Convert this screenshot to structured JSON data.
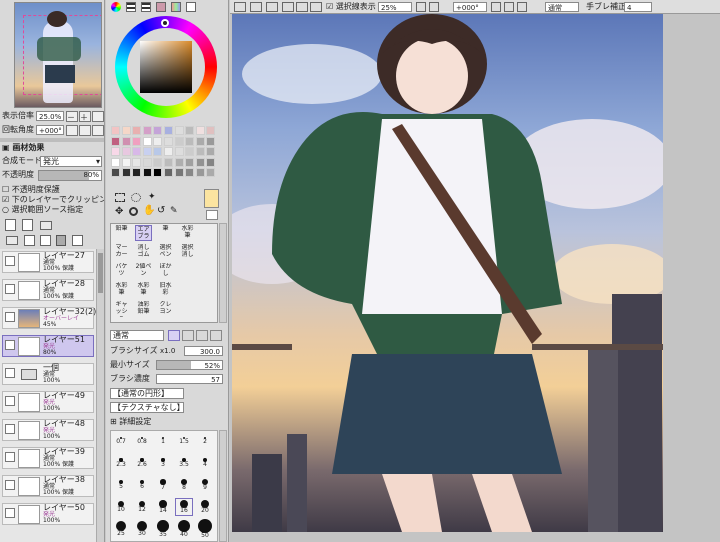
{
  "navigator": {
    "zoom_label": "表示倍率",
    "zoom_value": "25.0%",
    "rotate_label": "回転角度",
    "rotate_value": "+000°"
  },
  "effects": {
    "header": "画材効果",
    "blend_label": "合成モード",
    "blend_value": "発光",
    "opacity_label": "不透明度",
    "opacity_value": "80%",
    "opacity_fraction": 0.8,
    "check_protect": "不透明度保護",
    "check_clip": "下のレイヤーでクリッピング",
    "check_source": "選択範囲ソース指定"
  },
  "layers": [
    {
      "name": "レイヤー27",
      "mode": "通常",
      "opacity": "100% 保護"
    },
    {
      "name": "レイヤー28",
      "mode": "通常",
      "opacity": "100% 保護"
    },
    {
      "name": "レイヤー32(2)",
      "mode": "オーバーレイ",
      "opacity": "45%"
    },
    {
      "name": "レイヤー51",
      "mode": "発光",
      "opacity": "80%"
    },
    {
      "name": "一個",
      "mode": "通常",
      "opacity": "100%"
    },
    {
      "name": "レイヤー49",
      "mode": "発光",
      "opacity": "100%"
    },
    {
      "name": "レイヤー48",
      "mode": "発光",
      "opacity": "100%"
    },
    {
      "name": "レイヤー39",
      "mode": "通常",
      "opacity": "100% 保護"
    },
    {
      "name": "レイヤー38",
      "mode": "通常",
      "opacity": "100% 保護"
    },
    {
      "name": "レイヤー50",
      "mode": "発光",
      "opacity": "100%"
    }
  ],
  "tools": {
    "row1": [
      "鉛筆",
      "エアブラシ",
      "筆",
      "水彩筆"
    ],
    "row2": [
      "マーカー",
      "消しゴム",
      "選択ペン",
      "選択消し"
    ],
    "row3": [
      "バケツ",
      "2値ペン",
      "ぼかし",
      ""
    ],
    "row4": [
      "水彩筆",
      "水彩筆",
      "旧水彩",
      ""
    ],
    "row5": [
      "ギャッシュ",
      "油彩鉛筆",
      "クレヨン",
      ""
    ]
  },
  "brush": {
    "mode_value": "通常",
    "size_label": "ブラシサイズ",
    "size_mult": "x1.0",
    "size_value": "300.0",
    "min_label": "最小サイズ",
    "min_value": "52%",
    "density_label": "ブラシ濃度",
    "density_value": "57",
    "shape_value": "【通常の円形】",
    "texture_value": "【テクスチャなし】",
    "detail_label": "詳細設定",
    "sizes_row1": [
      "0.7",
      "0.8",
      "1",
      "1.5",
      "2"
    ],
    "sizes_row2": [
      "2.3",
      "2.6",
      "3",
      "3.5",
      "4"
    ],
    "sizes_row3": [
      "5",
      "6",
      "7",
      "8",
      "9"
    ],
    "sizes_row4": [
      "10",
      "12",
      "14",
      "16",
      "20"
    ],
    "sizes_row5": [
      "25",
      "30",
      "35",
      "40",
      "50"
    ]
  },
  "toolbar": {
    "select_label": "選択線表示",
    "zoom_value": "25%",
    "rotate_value": "+000°",
    "blend_value": "通常",
    "stab_label": "手ブレ補正",
    "stab_value": "4"
  },
  "colors": {
    "primary": "#fbe4a0",
    "selected_layer": "#cfc7ee"
  }
}
